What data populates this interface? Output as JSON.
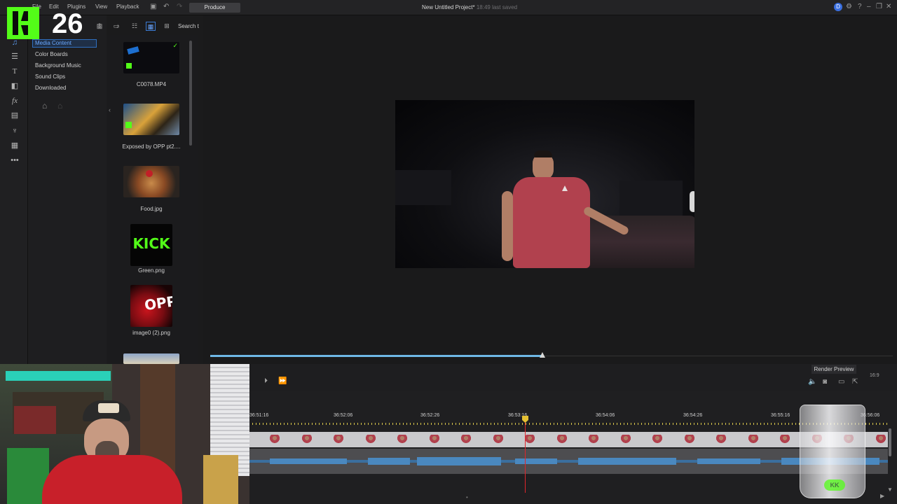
{
  "app": {
    "menu": [
      "File",
      "Edit",
      "Plugins",
      "View",
      "Playback"
    ],
    "produce_label": "Produce",
    "project_title": "New Untitled Project*",
    "project_saved": "18:49 last saved"
  },
  "overlay": {
    "stream_badge_number": "26",
    "glass_logo_text": "KK"
  },
  "library": {
    "categories": [
      "Media Content",
      "Color Boards",
      "Background Music",
      "Sound Clips",
      "Downloaded"
    ],
    "search_label": "Search t",
    "items": [
      {
        "label": "C0078.MP4"
      },
      {
        "label": "Exposed by OPP pt2...."
      },
      {
        "label": "Food.jpg"
      },
      {
        "label": "Green.png",
        "thumb_text": "KICK"
      },
      {
        "label": "image0 (2).png",
        "thumb_text": "OPP"
      }
    ]
  },
  "preview": {
    "progress": 0.5
  },
  "controls": {
    "render_preview_label": "Render Preview",
    "aspect_label": "16:9"
  },
  "timeline": {
    "ruler_labels": [
      "36:51:16",
      "36:52:06",
      "36:52:26",
      "36:53:16",
      "36:54:06",
      "36:54:26",
      "36:55:16",
      "36:56:06"
    ]
  },
  "colors": {
    "accent_blue": "#3a7bd5",
    "playhead_red": "#e0252b",
    "kick_green": "#53fc18",
    "progress_blue": "#6fb8e6"
  }
}
